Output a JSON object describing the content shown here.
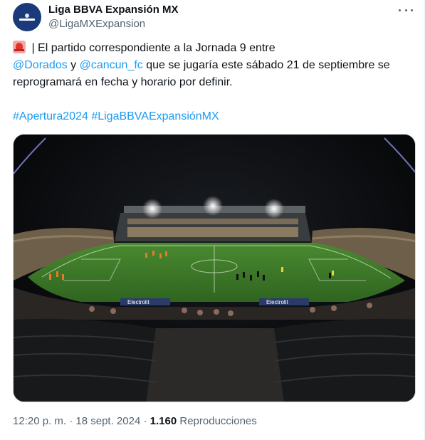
{
  "author": {
    "display_name": "Liga BBVA Expansión MX",
    "handle": "@LigaMXExpansion",
    "avatar_icon": "liga-expansion-logo"
  },
  "tweet": {
    "line1_text": " | El partido correspondiente a la Jornada 9 entre",
    "mention1": "@Dorados",
    "connector": " y ",
    "mention2": "@cancun_fc",
    "line2_rest": " que se jugaría este sábado 21 de septiembre se",
    "line3_text": "reprogramará en fecha y horario por definir.",
    "hashtag1": "#Apertura2024",
    "hashtag2": "#LigaBBVAExpansiónMX"
  },
  "media": {
    "banner_left": "Electrolit",
    "banner_right": "Electrolit"
  },
  "meta": {
    "time": "12:20 p. m.",
    "separator1": " · ",
    "date": "18 sept. 2024",
    "separator2": " · ",
    "views_count": "1.160",
    "views_label": " Reproducciones"
  },
  "colors": {
    "link": "#1d9bf0",
    "secondary_text": "#536471",
    "pitch": "#3f7a2a"
  }
}
